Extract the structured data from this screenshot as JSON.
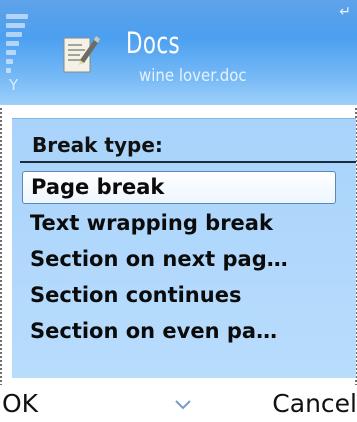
{
  "title_pane": {
    "app_title": "Docs",
    "document_name": "wine lover.doc"
  },
  "icons": {
    "signal": "signal-strength-icon",
    "antenna": "antenna-icon",
    "app": "docs-app-icon",
    "corner": "corner-indicator-icon",
    "scroll": "chevron-down-icon"
  },
  "dialog": {
    "heading": "Break type:",
    "options": [
      {
        "label": "Page break",
        "selected": true
      },
      {
        "label": "Text wrapping break",
        "selected": false
      },
      {
        "label": "Section on next pag…",
        "selected": false
      },
      {
        "label": "Section continues",
        "selected": false
      },
      {
        "label": "Section on even pa…",
        "selected": false
      }
    ]
  },
  "softkeys": {
    "left": "OK",
    "right": "Cancel"
  },
  "colors": {
    "title_pane": "#4a9ff0",
    "dialog_bg": "#b0d8fb",
    "selection_border": "#5e88b3"
  }
}
